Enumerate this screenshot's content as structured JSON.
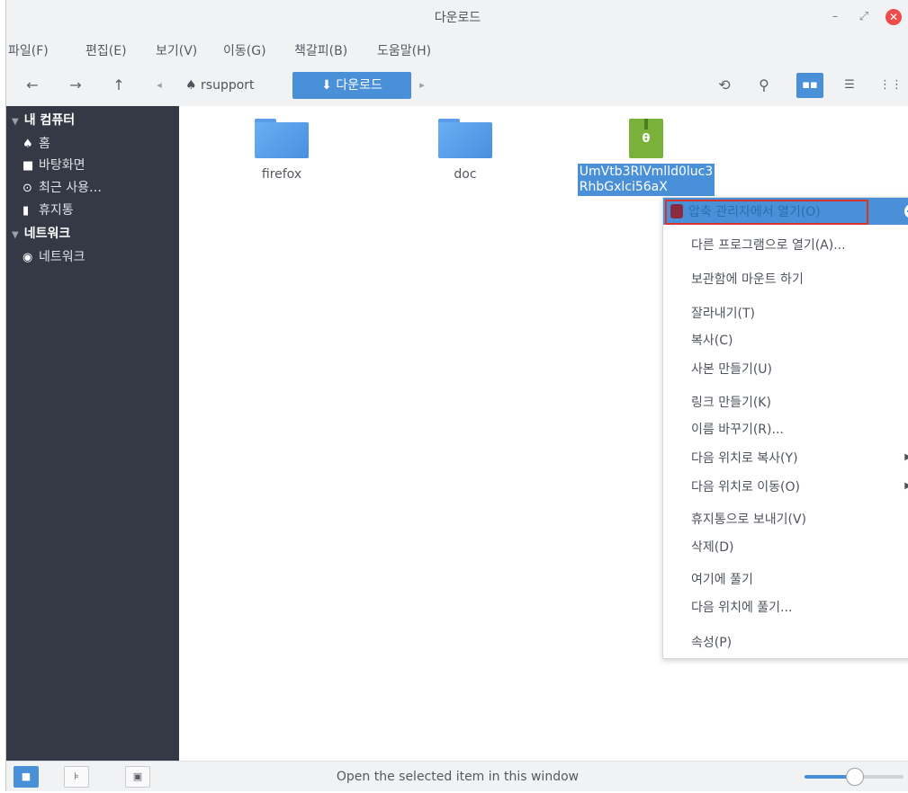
{
  "window": {
    "title": "다운로드"
  },
  "menubar": [
    "파일(F)",
    "편집(E)",
    "보기(V)",
    "이동(G)",
    "책갈피(B)",
    "도움말(H)"
  ],
  "toolbar": {
    "back": "←",
    "forward": "→",
    "up": "↑",
    "crumb_left": "◂",
    "home_crumb": "rsupport",
    "current_crumb": "다운로드",
    "crumb_right": "▸",
    "home_glyph": "♠",
    "download_glyph": "⬇",
    "refresh": "⟲",
    "search": "⚲",
    "view_icons": "▪▪",
    "view_compact": "☰",
    "view_list": "⋮⋮"
  },
  "sidebar": {
    "sections": [
      {
        "label": "내 컴퓨터"
      },
      {
        "label": "네트워크"
      }
    ],
    "items": [
      {
        "label": "홈",
        "icon": "home-icon",
        "glyph": "♠"
      },
      {
        "label": "바탕화면",
        "icon": "desktop-icon",
        "glyph": "■"
      },
      {
        "label": "최근 사용…",
        "icon": "recent-icon",
        "glyph": "⊙"
      },
      {
        "label": "휴지통",
        "icon": "trash-icon",
        "glyph": "▮"
      },
      {
        "label": "네트워크",
        "icon": "network-icon",
        "glyph": "◉"
      }
    ]
  },
  "files": [
    {
      "name": "firefox",
      "type": "folder"
    },
    {
      "name": "doc",
      "type": "folder"
    },
    {
      "name_line1": "UmVtb3RlVmlld0luc3",
      "name_line2": "RhbGxlci56aX",
      "type": "archive"
    }
  ],
  "context_menu": {
    "items": [
      "압축 관리자에서 열기(O)",
      "다른 프로그램으로 열기(A)...",
      "보관함에 마운트 하기",
      "잘라내기(T)",
      "복사(C)",
      "사본 만들기(U)",
      "링크 만들기(K)",
      "이름 바꾸기(R)...",
      "다음 위치로 복사(Y)",
      "다음 위치로 이동(O)",
      "휴지통으로 보내기(V)",
      "삭제(D)",
      "여기에 풀기",
      "다음 위치에 풀기...",
      "속성(P)"
    ]
  },
  "statusbar": {
    "text": "Open the selected item in this window",
    "zoom": 0.5
  },
  "colors": {
    "accent": "#4a90d9",
    "sidebar_bg": "#353945",
    "close_red": "#ef4b4b",
    "archive_green": "#79b13b"
  }
}
